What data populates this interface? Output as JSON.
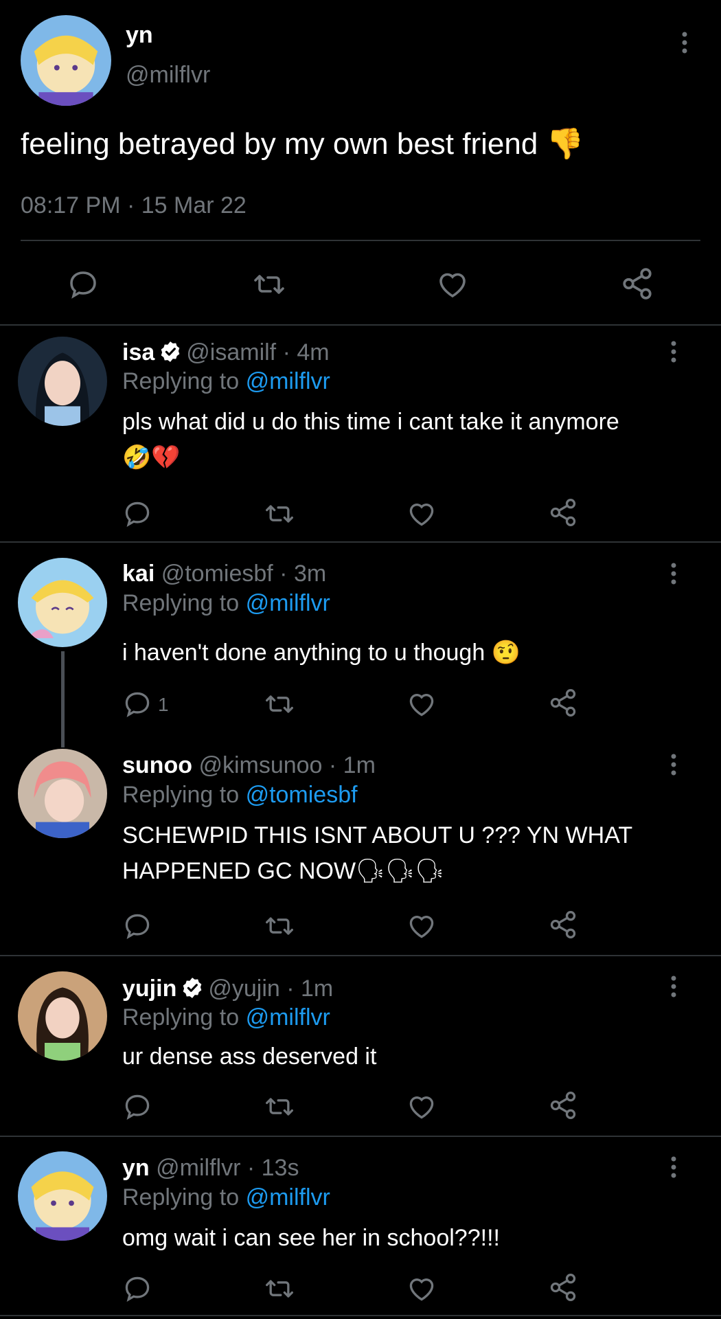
{
  "main_tweet": {
    "display_name": "yn",
    "handle": "@milflvr",
    "text": "feeling betrayed by my own best friend 👎",
    "timestamp": "08:17 PM · 15 Mar 22"
  },
  "replies": [
    {
      "display_name": "isa",
      "verified": true,
      "handle_time": "@isamilf · 4m",
      "replying_label": "Replying to",
      "replying_to": "@milflvr",
      "text_line1": "pls what did u do this time i cant take it anymore",
      "text_line2": "🤣💔"
    },
    {
      "display_name": "kai",
      "verified": false,
      "handle_time": "@tomiesbf · 3m",
      "replying_label": "Replying to",
      "replying_to": "@milflvr",
      "text_line1": "i haven't done anything to u though 🤨",
      "reply_count": "1"
    },
    {
      "display_name": "sunoo",
      "verified": false,
      "handle_time": "@kimsunoo · 1m",
      "replying_label": "Replying to",
      "replying_to": "@tomiesbf",
      "text_line1": "SCHEWPID THIS ISNT ABOUT U ??? YN WHAT",
      "text_line2": "HAPPENED GC NOW🗣🗣🗣"
    },
    {
      "display_name": "yujin",
      "verified": true,
      "handle_time": "@yujin · 1m",
      "replying_label": "Replying to",
      "replying_to": "@milflvr",
      "text_line1": "ur dense ass deserved it"
    },
    {
      "display_name": "yn",
      "verified": false,
      "handle_time": "@milflvr · 13s",
      "replying_label": "Replying to",
      "replying_to": "@milflvr",
      "text_line1": "omg wait i can see her in school??!!!"
    }
  ],
  "colors": {
    "background": "#000000",
    "muted": "#71767b",
    "link": "#1d9bf0",
    "separator": "#2f3336"
  }
}
